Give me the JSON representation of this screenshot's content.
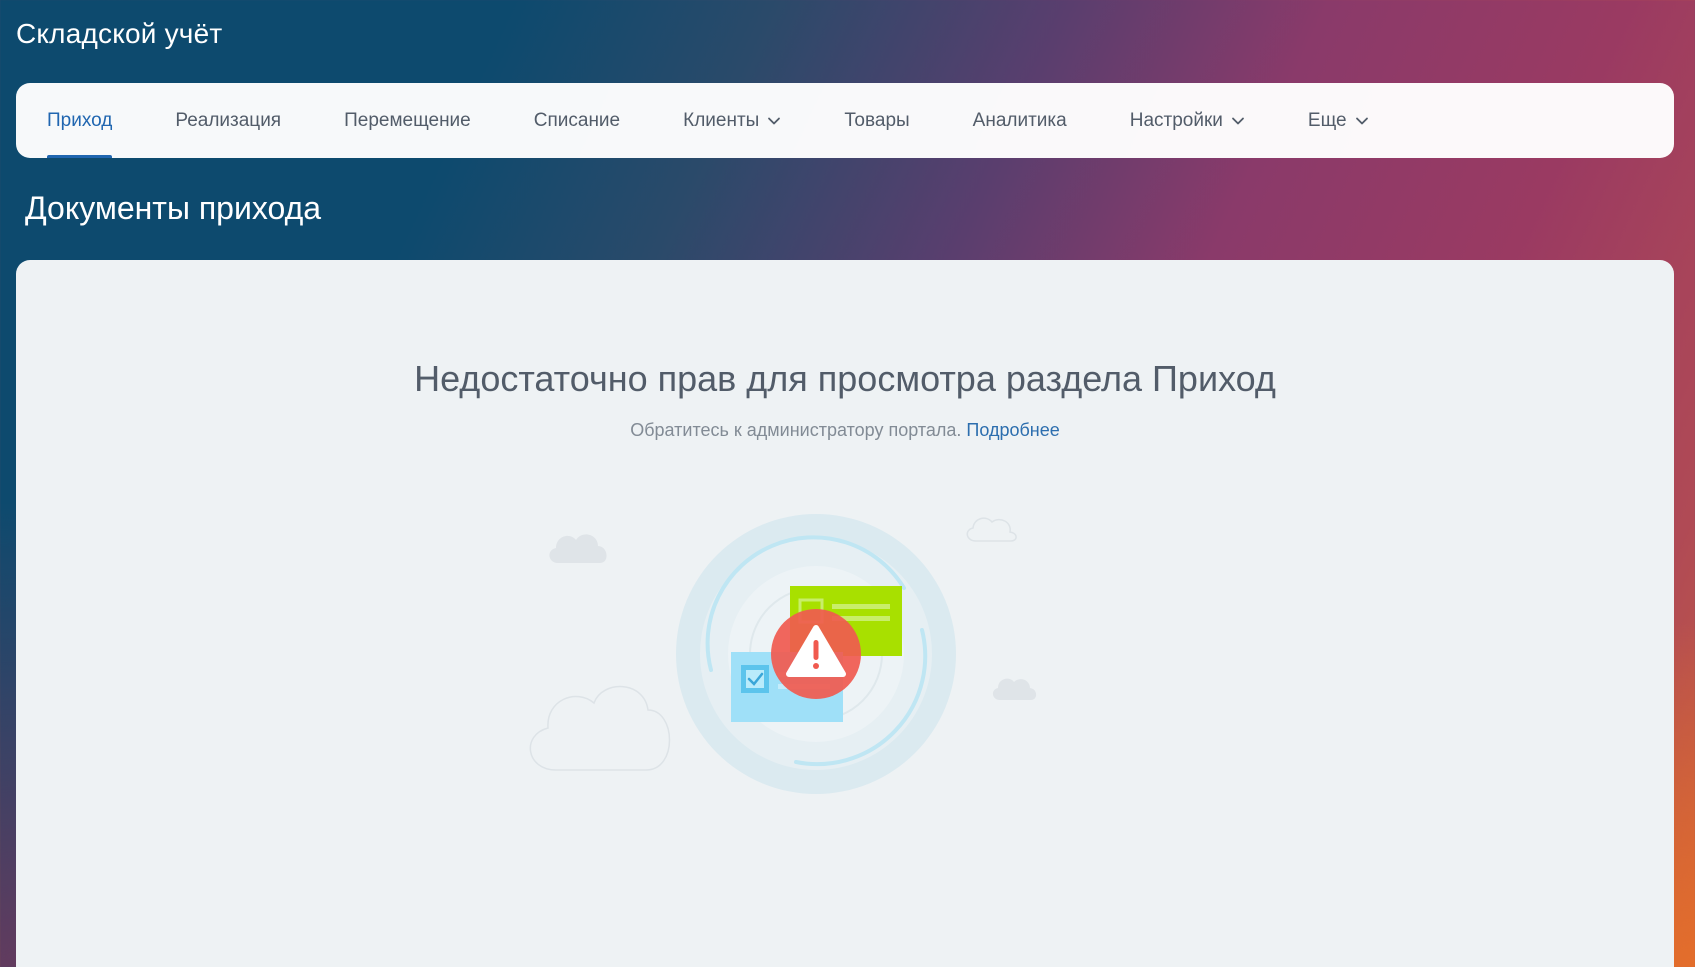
{
  "app": {
    "title": "Складской учёт"
  },
  "nav": {
    "items": [
      {
        "label": "Приход",
        "active": true,
        "has_dropdown": false
      },
      {
        "label": "Реализация",
        "active": false,
        "has_dropdown": false
      },
      {
        "label": "Перемещение",
        "active": false,
        "has_dropdown": false
      },
      {
        "label": "Списание",
        "active": false,
        "has_dropdown": false
      },
      {
        "label": "Клиенты",
        "active": false,
        "has_dropdown": true
      },
      {
        "label": "Товары",
        "active": false,
        "has_dropdown": false
      },
      {
        "label": "Аналитика",
        "active": false,
        "has_dropdown": false
      },
      {
        "label": "Настройки",
        "active": false,
        "has_dropdown": true
      },
      {
        "label": "Еще",
        "active": false,
        "has_dropdown": true
      }
    ]
  },
  "page": {
    "title": "Документы прихода"
  },
  "message": {
    "title": "Недостаточно прав для просмотра раздела Приход",
    "subtitle": "Обратитесь к администратору портала.",
    "link": "Подробнее"
  },
  "illustration": {
    "icons": [
      "cloud-icon",
      "document-card-icon",
      "checkbox-icon",
      "warning-icon"
    ]
  },
  "colors": {
    "accent": "#2066b0",
    "warning": "#f05a4f",
    "card_green": "#a8e000",
    "card_blue": "#9fe0f8"
  }
}
